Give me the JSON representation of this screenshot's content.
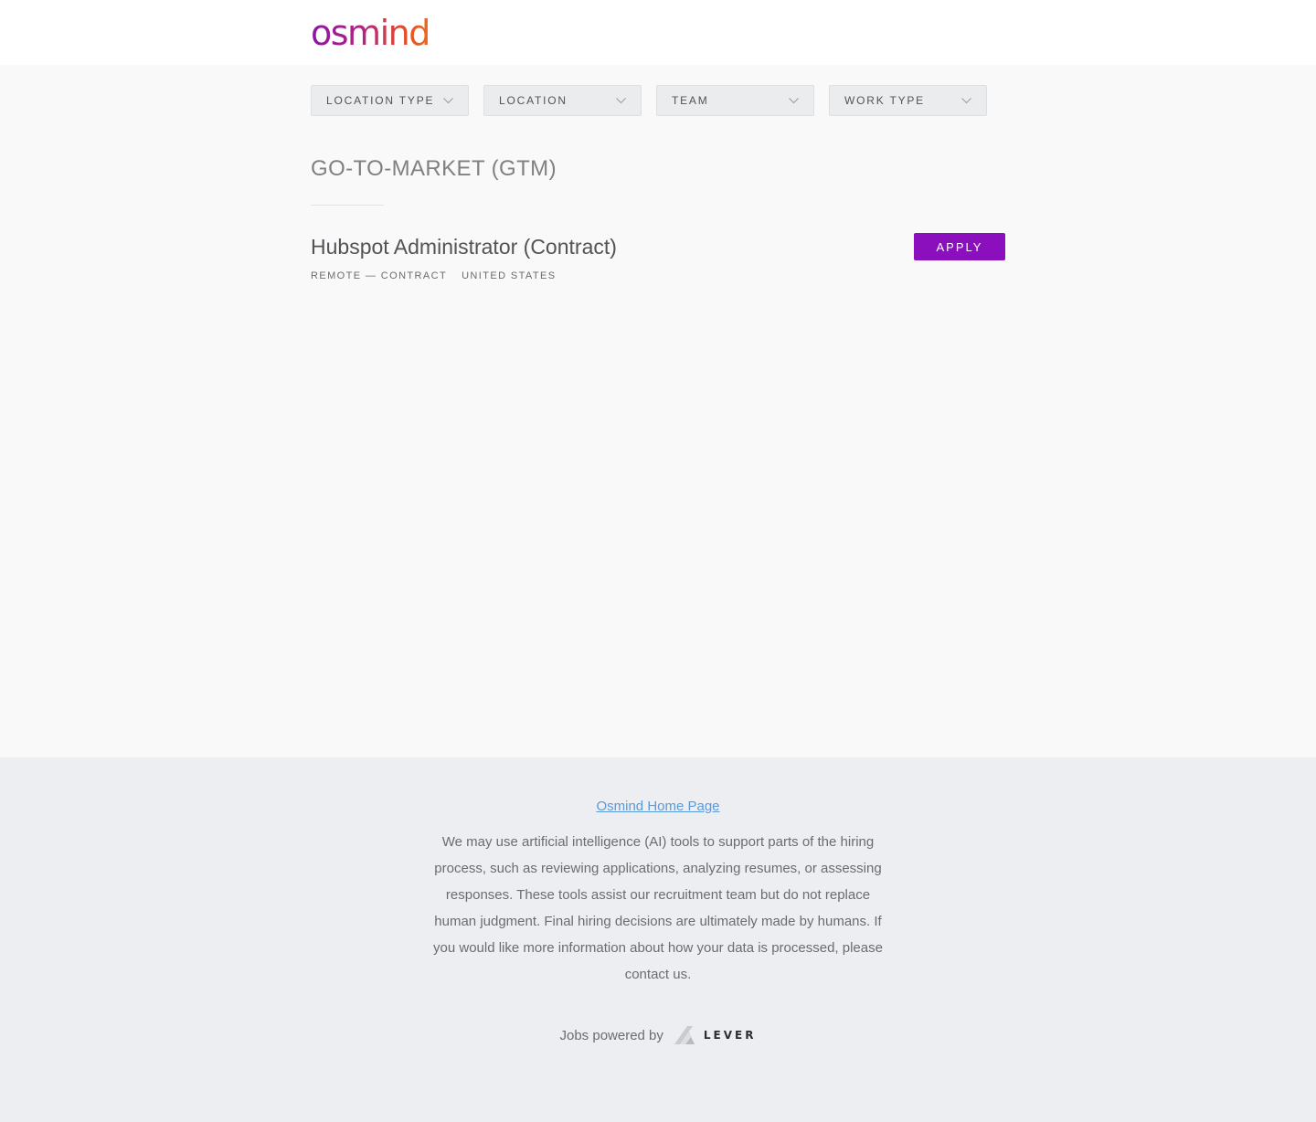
{
  "header": {
    "logo_text": "osmind"
  },
  "filters": [
    {
      "label": "LOCATION TYPE"
    },
    {
      "label": "LOCATION"
    },
    {
      "label": "TEAM"
    },
    {
      "label": "WORK TYPE"
    }
  ],
  "team": {
    "heading": "GO-TO-MARKET (GTM)"
  },
  "postings": [
    {
      "title": "Hubspot Administrator (Contract)",
      "commitment": "REMOTE — CONTRACT",
      "location": "UNITED STATES",
      "apply_label": "APPLY"
    }
  ],
  "footer": {
    "home_link": "Osmind Home Page",
    "ai_note": "We may use artificial intelligence (AI) tools to support parts of the hiring process, such as reviewing applications, analyzing resumes, or assessing responses. These tools assist our recruitment team but do not replace human judgment. Final hiring decisions are ultimately made by humans. If you would like more information about how your data is processed, please contact us.",
    "powered_by": "Jobs powered by",
    "lever_logo_text": "LEVER"
  },
  "colors": {
    "apply_button": "#8c0fbd",
    "link": "#5c9ad9",
    "logo_gradient_start": "#8c14a6",
    "logo_gradient_end": "#f0691b"
  }
}
